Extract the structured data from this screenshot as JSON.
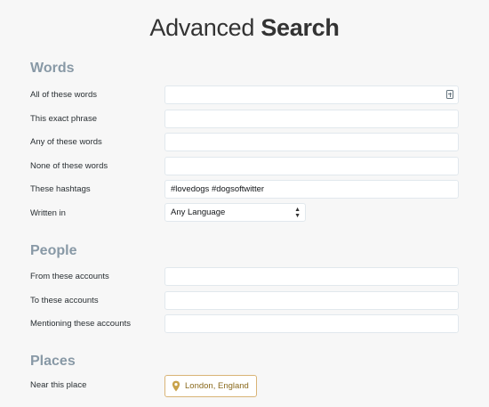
{
  "page": {
    "title_light": "Advanced ",
    "title_bold": "Search"
  },
  "words": {
    "heading": "Words",
    "all_label": "All of these words",
    "all_value": "",
    "all_icon": "form-fill-icon",
    "exact_label": "This exact phrase",
    "exact_value": "",
    "any_label": "Any of these words",
    "any_value": "",
    "none_label": "None of these words",
    "none_value": "",
    "hashtags_label": "These hashtags",
    "hashtags_value": "#lovedogs #dogsoftwitter",
    "language_label": "Written in",
    "language_value": "Any Language"
  },
  "people": {
    "heading": "People",
    "from_label": "From these accounts",
    "from_value": "",
    "to_label": "To these accounts",
    "to_value": "",
    "mentioning_label": "Mentioning these accounts",
    "mentioning_value": ""
  },
  "places": {
    "heading": "Places",
    "near_label": "Near this place",
    "near_value": "London, England",
    "near_icon": "location-pin-icon"
  },
  "colors": {
    "heading": "#8899a6",
    "field_border": "#e1e8ed",
    "place_accent": "#c8a24a"
  }
}
